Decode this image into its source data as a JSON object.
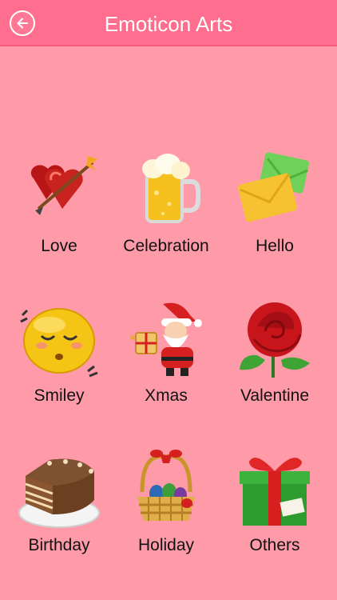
{
  "header": {
    "title": "Emoticon Arts",
    "back_icon": "arrow-left-icon",
    "bg_color": "#FF6E8E"
  },
  "categories": [
    {
      "label": "Love",
      "icon": "heart-arrow-icon"
    },
    {
      "label": "Celebration",
      "icon": "beer-mug-icon"
    },
    {
      "label": "Hello",
      "icon": "envelopes-icon"
    },
    {
      "label": "Smiley",
      "icon": "smiley-face-icon"
    },
    {
      "label": "Xmas",
      "icon": "santa-icon"
    },
    {
      "label": "Valentine",
      "icon": "rose-icon"
    },
    {
      "label": "Birthday",
      "icon": "cake-icon"
    },
    {
      "label": "Holiday",
      "icon": "egg-basket-icon"
    },
    {
      "label": "Others",
      "icon": "gift-box-icon"
    }
  ],
  "background_color": "#FF9AA9"
}
